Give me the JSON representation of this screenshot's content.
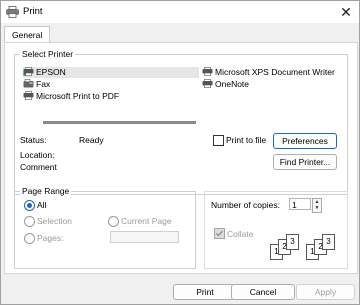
{
  "window": {
    "title": "Print",
    "close_glyph": "✕"
  },
  "tabs": [
    {
      "label": "General"
    }
  ],
  "select_printer": {
    "label": "Select Printer",
    "printers": [
      {
        "name": "EPSON",
        "selected": true,
        "icon": "printer-default-icon"
      },
      {
        "name": "Fax",
        "selected": false,
        "icon": "fax-icon"
      },
      {
        "name": "Microsoft Print to PDF",
        "selected": false,
        "icon": "printer-icon"
      },
      {
        "name": "Microsoft XPS Document Writer",
        "selected": false,
        "icon": "printer-icon"
      },
      {
        "name": "OneNote",
        "selected": false,
        "icon": "printer-icon"
      }
    ],
    "progress_fraction": 1.0,
    "status_label": "Status:",
    "status_value": "Ready",
    "location_label": "Location:",
    "location_value": "",
    "comment_label": "Comment",
    "comment_value": "",
    "print_to_file_label": "Print to file",
    "print_to_file_checked": false,
    "preferences_button": "Preferences",
    "find_printer_button": "Find Printer..."
  },
  "page_range": {
    "label": "Page Range",
    "all_label": "All",
    "selection_label": "Selection",
    "current_page_label": "Current Page",
    "pages_label": "Pages:",
    "pages_value": "",
    "selected_option": "All"
  },
  "copies": {
    "number_label": "Number of copies:",
    "number_value": "1",
    "collate_label": "Collate",
    "collate_checked": true,
    "collate_digits": [
      "1",
      "2",
      "3"
    ]
  },
  "footer": {
    "print_button": "Print",
    "cancel_button": "Cancel",
    "apply_button": "Apply"
  },
  "colors": {
    "accent": "#1a66c6",
    "selected_row": "#e5e5e5"
  }
}
